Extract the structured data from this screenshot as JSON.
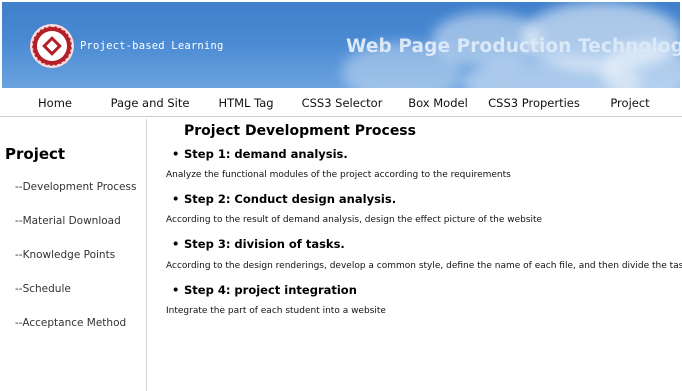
{
  "header": {
    "brand_text": "Project-based Learning",
    "title": "Web Page Production Technology",
    "logo_icon": "university-seal-icon"
  },
  "nav": {
    "items": [
      {
        "label": "Home"
      },
      {
        "label": "Page and Site"
      },
      {
        "label": "HTML Tag"
      },
      {
        "label": "CSS3 Selector"
      },
      {
        "label": "Box Model"
      },
      {
        "label": "CSS3 Properties"
      },
      {
        "label": "Project"
      }
    ]
  },
  "sidebar": {
    "heading": "Project",
    "items": [
      {
        "label": "--Development Process"
      },
      {
        "label": "--Material Download"
      },
      {
        "label": "--Knowledge Points"
      },
      {
        "label": "--Schedule"
      },
      {
        "label": "--Acceptance Method"
      }
    ]
  },
  "main": {
    "title": "Project Development Process",
    "steps": [
      {
        "title": "Step 1: demand analysis.",
        "description": "Analyze the functional modules of the project according to the requirements"
      },
      {
        "title": "Step 2: Conduct design analysis.",
        "description": "According to the result of demand analysis, design the effect picture of the website"
      },
      {
        "title": "Step 3: division of tasks.",
        "description": "According to the design renderings, develop a common style, define the name of each file, and then divide the tasks"
      },
      {
        "title": "Step 4: project integration",
        "description": "Integrate the part of each student into a website"
      }
    ]
  },
  "colors": {
    "banner": "#4a8ad3",
    "logo": "#b51f2a"
  }
}
